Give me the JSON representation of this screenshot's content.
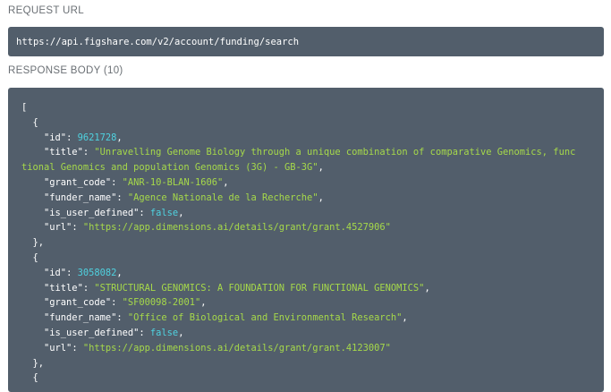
{
  "request_url_label": "REQUEST URL",
  "request_url": "https://api.figshare.com/v2/account/funding/search",
  "response_body_label": "RESPONSE BODY (10)",
  "records": [
    {
      "id": "9621728",
      "title_part1": "\"Unravelling Genome Biology through a unique combination of comparative Genomics, func",
      "title_part2": "tional Genomics and population Genomics (3G) - GB-3G\"",
      "grant_code": "\"ANR-10-BLAN-1606\"",
      "funder_name": "\"Agence Nationale de la Recherche\"",
      "is_user_defined": "false",
      "url": "\"https://app.dimensions.ai/details/grant/grant.4527906\""
    },
    {
      "id": "3058082",
      "title": "\"STRUCTURAL GENOMICS: A FOUNDATION FOR FUNCTIONAL GENOMICS\"",
      "grant_code": "\"SF00098-2001\"",
      "funder_name": "\"Office of Biological and Environmental Research\"",
      "is_user_defined": "false",
      "url": "\"https://app.dimensions.ai/details/grant/grant.4123007\""
    }
  ],
  "keys": {
    "id": "\"id\"",
    "title": "\"title\"",
    "grant_code": "\"grant_code\"",
    "funder_name": "\"funder_name\"",
    "is_user_defined": "\"is_user_defined\"",
    "url": "\"url\""
  },
  "punct": {
    "open_bracket": "[",
    "open_brace": "{",
    "close_brace_comma": "},"
  },
  "colors": {
    "panel_bg": "#525e6b",
    "string": "#a6d94a",
    "number": "#4fd2e0",
    "boolean": "#4fd2e0"
  }
}
